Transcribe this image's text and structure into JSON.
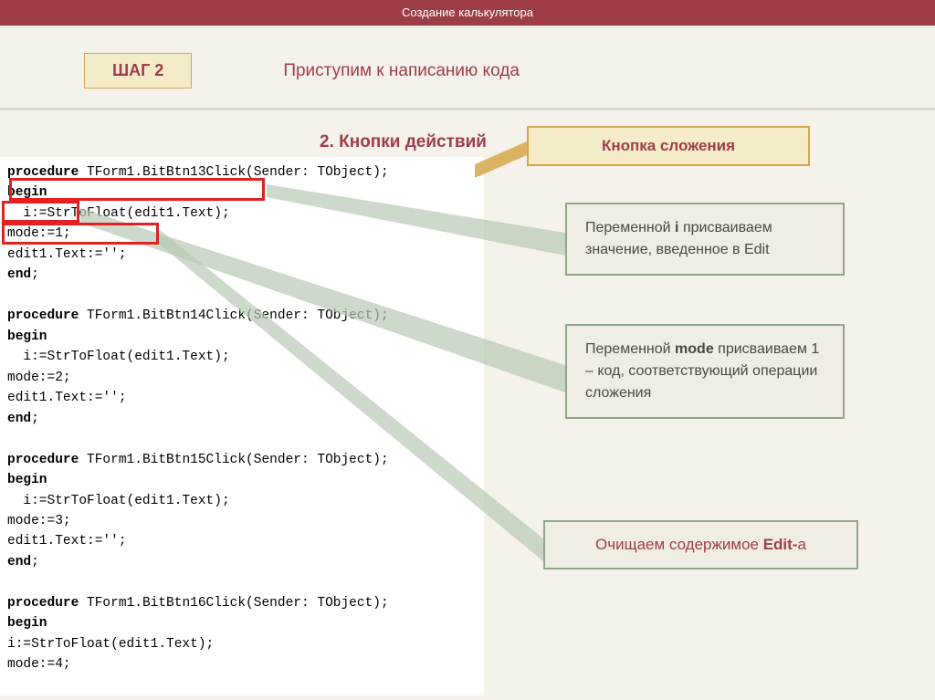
{
  "topbar": "Создание калькулятора",
  "step": {
    "label": "ШАГ 2",
    "title": "Приступим к написанию кода"
  },
  "section_title": "2.  Кнопки действий",
  "callout_title": "Кнопка сложения",
  "code": {
    "l1a": "procedure",
    "l1b": " TForm1.BitBtn13Click(Sender: TObject);",
    "l2": "begin",
    "l3": "  i:=StrToFloat(edit1.Text);",
    "l4": "mode:=1;",
    "l5": "edit1.Text:='';",
    "l6a": "end",
    "l6b": ";",
    "sp": "",
    "l7a": "procedure",
    "l7b": " TForm1.BitBtn14Click(Sender: TObject);",
    "l8": "begin",
    "l9": "  i:=StrToFloat(edit1.Text);",
    "l10": "mode:=2;",
    "l11": "edit1.Text:='';",
    "l12a": "end",
    "l12b": ";",
    "l13a": "procedure",
    "l13b": " TForm1.BitBtn15Click(Sender: TObject);",
    "l14": "begin",
    "l15": "  i:=StrToFloat(edit1.Text);",
    "l16": "mode:=3;",
    "l17": "edit1.Text:='';",
    "l18a": "end",
    "l18b": ";",
    "l19a": "procedure",
    "l19b": " TForm1.BitBtn16Click(Sender: TObject);",
    "l20": "begin",
    "l21": "i:=StrToFloat(edit1.Text);",
    "l22": "mode:=4;"
  },
  "annot1": {
    "pre": "Переменной ",
    "bold": "i",
    "post": " присваиваем значение, введенное в Edit"
  },
  "annot2": {
    "pre": "Переменной ",
    "bold": "mode",
    "post": " присваиваем 1 – код, соответствующий операции сложения"
  },
  "annot3": {
    "pre": "Очищаем содержимое ",
    "bold": "Edit-",
    "post": "а"
  }
}
